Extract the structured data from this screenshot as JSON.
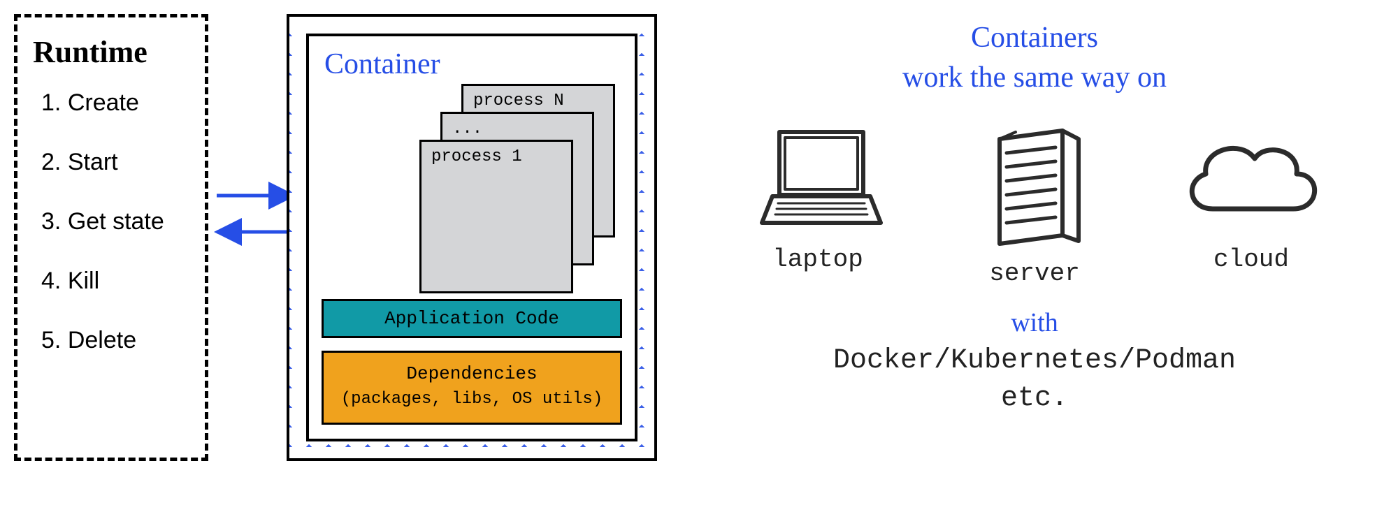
{
  "runtime": {
    "title": "Runtime",
    "ops": [
      "Create",
      "Start",
      "Get state",
      "Kill",
      "Delete"
    ]
  },
  "container": {
    "title": "Container",
    "processes": {
      "first": "process 1",
      "mid": "...",
      "last": "process N"
    },
    "appcode": "Application Code",
    "deps_title": "Dependencies",
    "deps_sub": "(packages, libs, OS utils)"
  },
  "right": {
    "tagline_l1": "Containers",
    "tagline_l2": "work the same way on",
    "envs": {
      "laptop": "laptop",
      "server": "server",
      "cloud": "cloud"
    },
    "with": "with",
    "tools_l1": "Docker/Kubernetes/Podman",
    "tools_l2": "etc."
  }
}
